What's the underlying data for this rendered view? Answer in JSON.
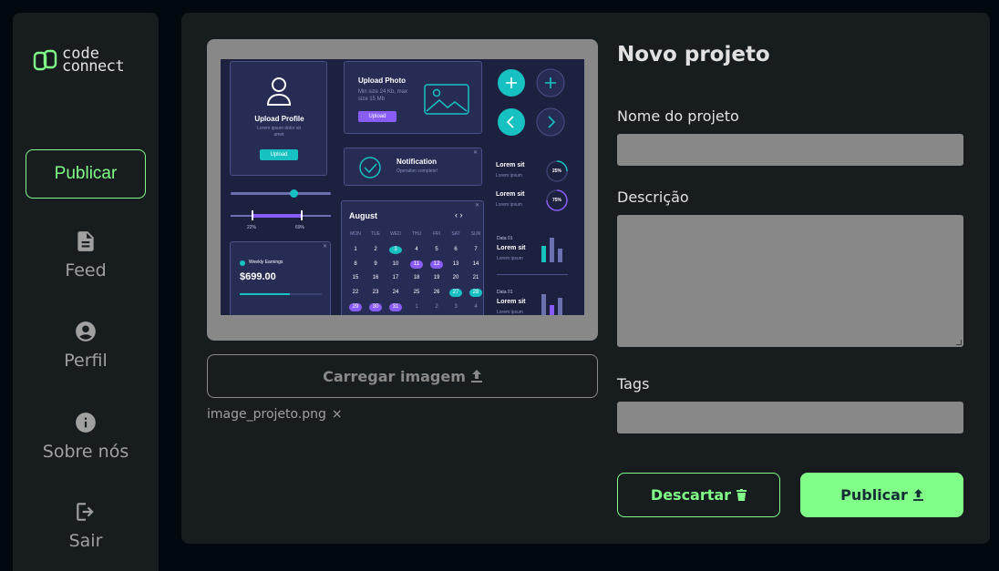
{
  "sidebar": {
    "logo": {
      "line1": "code",
      "line2": "connect"
    },
    "publish_label": "Publicar",
    "items": [
      {
        "label": "Feed",
        "icon": "document-icon"
      },
      {
        "label": "Perfil",
        "icon": "account-circle-icon"
      },
      {
        "label": "Sobre nós",
        "icon": "info-icon"
      },
      {
        "label": "Sair",
        "icon": "logout-icon"
      }
    ]
  },
  "upload": {
    "button_label": "Carregar imagem",
    "filename": "image_projeto.png",
    "remove_symbol": "×"
  },
  "preview": {
    "upload_profile_title": "Upload Profile",
    "upload_profile_desc": "Lorem ipsum dolor sit amet",
    "upload_profile_btn": "Upload",
    "upload_photo_title": "Upload Photo",
    "upload_photo_desc": "Min size 24 Kb, max size 15 Mb",
    "upload_photo_btn": "Upload",
    "notification_title": "Notification",
    "notification_desc": "Operation complete!",
    "slider_min": "22%",
    "slider_max": "69%",
    "earnings_label": "Weekly Earnings",
    "earnings_value": "$699.00",
    "calendar_month": "August",
    "weekdays": [
      "MON",
      "TUE",
      "WED",
      "THU",
      "FRI",
      "SAT",
      "SUN"
    ],
    "weeks": [
      [
        "1",
        "2",
        "3",
        "4",
        "5",
        "6",
        "7"
      ],
      [
        "8",
        "9",
        "10",
        "11",
        "12",
        "13",
        "14"
      ],
      [
        "15",
        "16",
        "17",
        "18",
        "19",
        "20",
        "21"
      ],
      [
        "22",
        "23",
        "24",
        "25",
        "26",
        "27",
        "28"
      ],
      [
        "29",
        "30",
        "31",
        "1",
        "2",
        "3",
        "4"
      ]
    ],
    "stat1_title": "Lorem sit",
    "stat1_sub": "Lorem ipsum",
    "stat1_value": "25%",
    "stat2_title": "Lorem sit",
    "stat2_sub": "Lorem ipsum",
    "stat2_value": "75%",
    "data1_label": "Data 01",
    "data1_title": "Lorem sit",
    "data1_sub": "Lorem ipsum",
    "data2_label": "Data 01",
    "data2_title": "Lorem sit",
    "data2_sub": "Lorem ipsum"
  },
  "form": {
    "title": "Novo projeto",
    "name_label": "Nome do projeto",
    "name_value": "",
    "description_label": "Descrição",
    "description_value": "",
    "tags_label": "Tags",
    "tags_value": "",
    "discard_label": "Descartar",
    "publish_label": "Publicar"
  },
  "colors": {
    "accent": "#81fe88",
    "background": "#01080e",
    "surface": "#171d1f",
    "field": "#888888"
  }
}
